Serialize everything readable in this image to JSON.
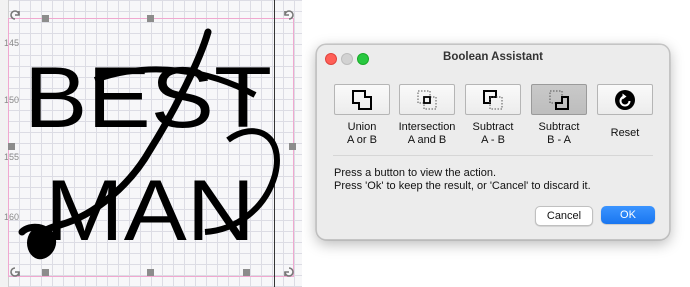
{
  "canvas": {
    "ruler_labels": [
      "145",
      "150",
      "155",
      "160"
    ],
    "artwork_lines": [
      "BEST",
      "MAN"
    ]
  },
  "dialog": {
    "title": "Boolean Assistant",
    "buttons": [
      {
        "label_line1": "Union",
        "label_line2": "A or B",
        "icon": "union-icon"
      },
      {
        "label_line1": "Intersection",
        "label_line2": "A and B",
        "icon": "intersection-icon"
      },
      {
        "label_line1": "Subtract",
        "label_line2": "A - B",
        "icon": "subtract-a-b-icon"
      },
      {
        "label_line1": "Subtract",
        "label_line2": "B - A",
        "icon": "subtract-b-a-icon",
        "active": true
      },
      {
        "label_line1": "Reset",
        "label_line2": "",
        "icon": "reset-icon"
      }
    ],
    "message_line1": "Press a button to view the action.",
    "message_line2": "Press 'Ok' to keep the result, or 'Cancel' to discard it.",
    "cancel_label": "Cancel",
    "ok_label": "OK"
  },
  "colors": {
    "accent": "#1976f0",
    "selection": "#f0a8d0"
  }
}
